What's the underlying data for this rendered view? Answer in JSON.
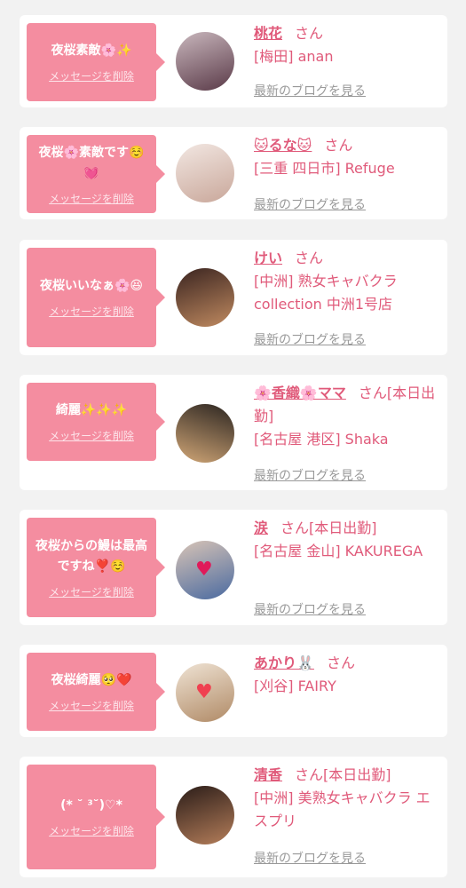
{
  "messages": [
    {
      "message": "夜桜素敵🌸✨",
      "delete_label": "メッセージを削除",
      "name": "桃花",
      "honorific": "さん",
      "shop": "[梅田] anan",
      "blog_link": "最新のブログを見る",
      "avatar_colors": [
        "#c9b7bd",
        "#5a3a48"
      ]
    },
    {
      "message": "夜桜🌸素敵です☺️💓",
      "delete_label": "メッセージを削除",
      "name": "🐱るな🐱",
      "honorific": "さん",
      "shop": "[三重 四日市] Refuge",
      "blog_link": "最新のブログを見る",
      "avatar_colors": [
        "#f2e7e2",
        "#c9a79a"
      ]
    },
    {
      "message": "夜桜いいなぁ🌸😆",
      "delete_label": "メッセージを削除",
      "name": "けい",
      "honorific": "さん",
      "shop": "[中洲] 熟女キャバクラ collection 中洲1号店",
      "blog_link": "最新のブログを見る",
      "avatar_colors": [
        "#3a2420",
        "#c08a60"
      ]
    },
    {
      "message": "綺麗✨✨✨",
      "delete_label": "メッセージを削除",
      "name": "🌸香織🌸ママ",
      "honorific": "さん[本日出勤]",
      "shop": "[名古屋 港区] Shaka",
      "blog_link": "最新のブログを見る",
      "avatar_colors": [
        "#2a2420",
        "#d2a777"
      ]
    },
    {
      "message": "夜桜からの鰻は最高ですね❣️☺️",
      "delete_label": "メッセージを削除",
      "name": "涙",
      "honorific": "さん[本日出勤]",
      "shop": "[名古屋 金山] KAKUREGA",
      "blog_link": "最新のブログを見る",
      "avatar_colors": [
        "#d8c4b6",
        "#4a6aa0"
      ]
    },
    {
      "message": "夜桜綺麗🥺❤️",
      "delete_label": "メッセージを削除",
      "name": "あかり🐰",
      "honorific": "さん",
      "shop": "[刈谷] FAIRY",
      "blog_link": "",
      "avatar_colors": [
        "#efe3d4",
        "#b08a66"
      ]
    },
    {
      "message": "(* ˘ ³˘)♡*",
      "delete_label": "メッセージを削除",
      "name": "清香",
      "honorific": "さん[本日出勤]",
      "shop": "[中洲] 美熟女キャバクラ エスプリ",
      "blog_link": "最新のブログを見る",
      "avatar_colors": [
        "#2a1c18",
        "#b57e5a"
      ]
    }
  ],
  "colors": {
    "bubble": "#f48da0",
    "accent": "#e05a7a",
    "muted": "#999999",
    "background": "#f2f2f2"
  }
}
